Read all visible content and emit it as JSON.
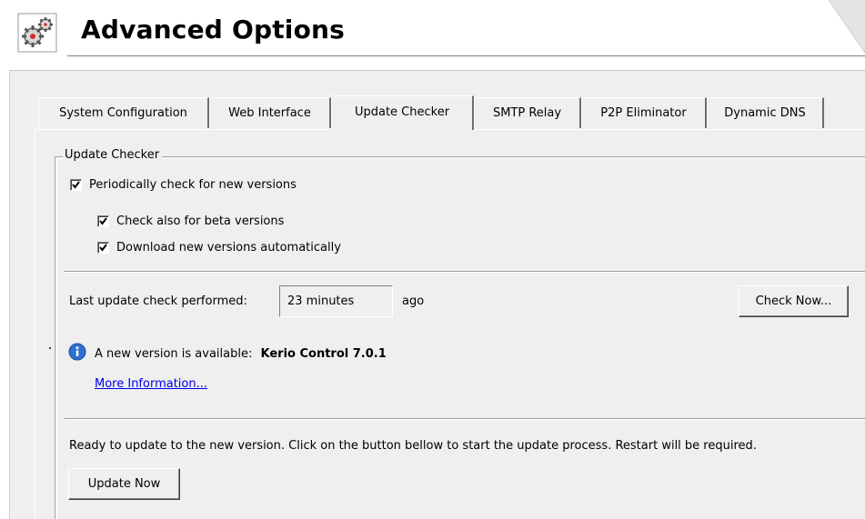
{
  "header": {
    "title": "Advanced Options",
    "icon": "gears-icon"
  },
  "tabs": [
    {
      "label": "System Configuration",
      "active": false
    },
    {
      "label": "Web Interface",
      "active": false
    },
    {
      "label": "Update Checker",
      "active": true
    },
    {
      "label": "SMTP Relay",
      "active": false
    },
    {
      "label": "P2P Eliminator",
      "active": false
    },
    {
      "label": "Dynamic DNS",
      "active": false
    }
  ],
  "update_checker": {
    "group_title": "Update Checker",
    "periodic_check": {
      "label": "Periodically check for new versions",
      "checked": true
    },
    "beta_check": {
      "label": "Check also for beta versions",
      "checked": true
    },
    "auto_download": {
      "label": "Download new versions automatically",
      "checked": true
    },
    "last_check_label": "Last update check performed:",
    "last_check_value": "23 minutes",
    "last_check_suffix": "ago",
    "check_now_button": "Check Now...",
    "new_version_prefix": "A new version is available:",
    "new_version_name": "Kerio Control 7.0.1",
    "more_info_link": "More Information...",
    "ready_text": "Ready to update to the new version. Click on the button bellow to start the update process. Restart will be required.",
    "update_now_button": "Update Now"
  },
  "colors": {
    "panel_bg": "#efefef",
    "link": "#0000ee",
    "info_icon": "#2f6fd1"
  }
}
